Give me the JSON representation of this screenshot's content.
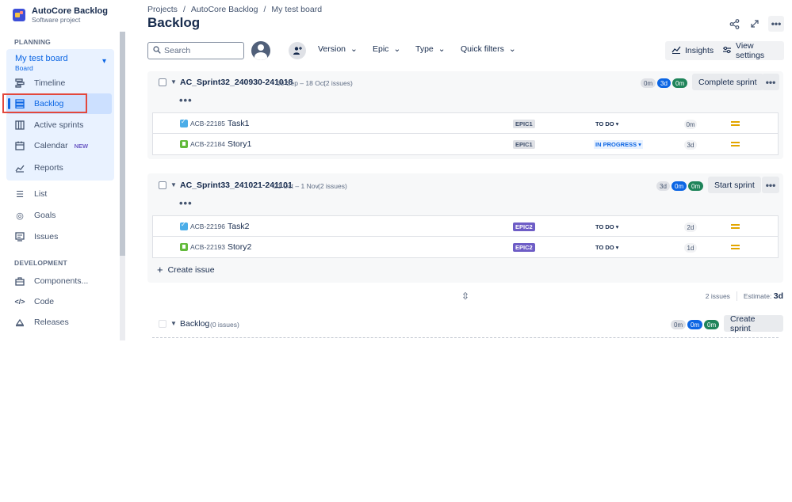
{
  "project": {
    "name": "AutoCore Backlog",
    "type": "Software project"
  },
  "sidebar": {
    "planning_label": "PLANNING",
    "board": {
      "name": "My test board",
      "sub": "Board"
    },
    "planning_items": [
      {
        "label": "Timeline",
        "icon": "timeline-icon"
      },
      {
        "label": "Backlog",
        "icon": "backlog-icon"
      },
      {
        "label": "Active sprints",
        "icon": "board-icon"
      },
      {
        "label": "Calendar",
        "icon": "calendar-icon",
        "badge": "NEW"
      },
      {
        "label": "Reports",
        "icon": "reports-icon"
      }
    ],
    "other_items": [
      {
        "label": "List",
        "icon": "list-icon"
      },
      {
        "label": "Goals",
        "icon": "goals-icon"
      },
      {
        "label": "Issues",
        "icon": "issues-icon"
      }
    ],
    "development_label": "DEVELOPMENT",
    "development_items": [
      {
        "label": "Components...",
        "icon": "components-icon"
      },
      {
        "label": "Code",
        "icon": "code-icon"
      },
      {
        "label": "Releases",
        "icon": "releases-icon"
      }
    ]
  },
  "breadcrumb": [
    "Projects",
    "/",
    "AutoCore Backlog",
    "/",
    "My test board"
  ],
  "page_title": "Backlog",
  "toolbar": {
    "search_placeholder": "Search",
    "filters": [
      "Version",
      "Epic",
      "Type",
      "Quick filters"
    ],
    "insights": "Insights",
    "view_settings": "View settings"
  },
  "sprints": [
    {
      "name": "AC_Sprint32_240930-241018",
      "dates": "30 Sep – 18 Oct",
      "count": "(2 issues)",
      "pills": [
        "0m",
        "3d",
        "0m"
      ],
      "action": "Complete sprint",
      "issues": [
        {
          "type": "task",
          "key": "ACB-22185",
          "summary": "Task1",
          "epic": "EPIC1",
          "epic_style": "gray",
          "status": "TO DO",
          "status_style": "todo",
          "estimate": "0m"
        },
        {
          "type": "story",
          "key": "ACB-22184",
          "summary": "Story1",
          "epic": "EPIC1",
          "epic_style": "gray",
          "status": "IN PROGRESS",
          "status_style": "inprog",
          "estimate": "3d"
        }
      ]
    },
    {
      "name": "AC_Sprint33_241021-241101",
      "dates": "21 Oct – 1 Nov",
      "count": "(2 issues)",
      "pills": [
        "3d",
        "0m",
        "0m"
      ],
      "action": "Start sprint",
      "issues": [
        {
          "type": "task",
          "key": "ACB-22196",
          "summary": "Task2",
          "epic": "EPIC2",
          "epic_style": "purple",
          "status": "TO DO",
          "status_style": "todo",
          "estimate": "2d"
        },
        {
          "type": "story",
          "key": "ACB-22193",
          "summary": "Story2",
          "epic": "EPIC2",
          "epic_style": "purple",
          "status": "TO DO",
          "status_style": "todo",
          "estimate": "1d"
        }
      ],
      "create_issue": "Create issue"
    }
  ],
  "summary": {
    "issues": "2 issues",
    "estimate_label": "Estimate:",
    "estimate_value": "3d"
  },
  "backlog": {
    "name": "Backlog",
    "count": "(0 issues)",
    "pills": [
      "0m",
      "0m",
      "0m"
    ],
    "action": "Create sprint"
  }
}
